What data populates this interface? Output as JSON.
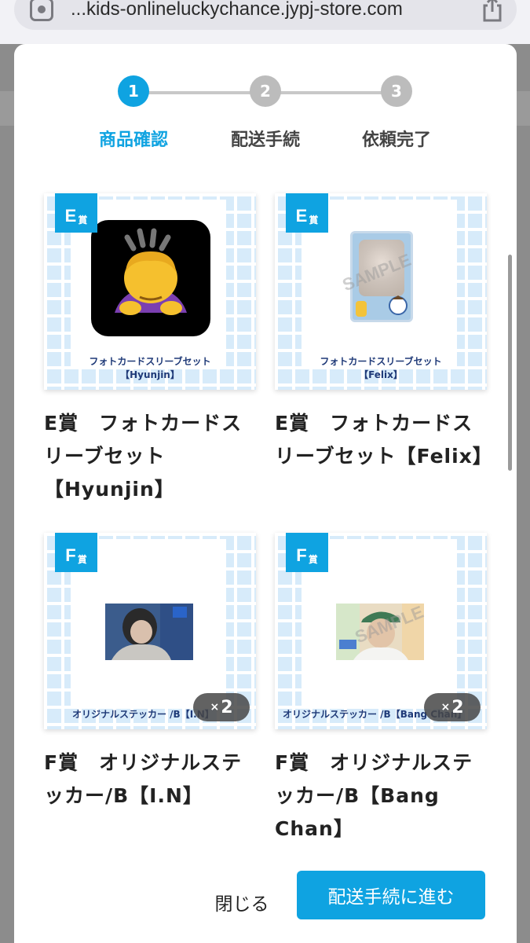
{
  "browser": {
    "url": "...kids-onlineluckychance.jypj-store.com"
  },
  "stepper": {
    "steps": [
      {
        "number": "1",
        "label": "商品確認"
      },
      {
        "number": "2",
        "label": "配送手続"
      },
      {
        "number": "3",
        "label": "依頼完了"
      }
    ]
  },
  "products": [
    {
      "badge": "E",
      "badge_suffix": "賞",
      "caption_line1": "フォトカードスリーブセット",
      "caption_line2": "【Hyunjin】",
      "title": "E賞　フォトカードスリーブセット【Hyunjin】",
      "qty": ""
    },
    {
      "badge": "E",
      "badge_suffix": "賞",
      "caption_line1": "フォトカードスリーブセット",
      "caption_line2": "【Felix】",
      "title": "E賞　フォトカードスリーブセット【Felix】",
      "qty": "",
      "watermark": "SAMPLE"
    },
    {
      "badge": "F",
      "badge_suffix": "賞",
      "caption_line1": "オリジナルステッカー /B【I.N】",
      "caption_line2": "",
      "title": "F賞　オリジナルステッカー/B【I.N】",
      "qty": "2",
      "qty_prefix": "×"
    },
    {
      "badge": "F",
      "badge_suffix": "賞",
      "caption_line1": "オリジナルステッカー /B【Bang Chan】",
      "caption_line2": "",
      "title": "F賞　オリジナルステッカー/B【Bang Chan】",
      "qty": "2",
      "qty_prefix": "×",
      "watermark": "SAMPLE"
    }
  ],
  "footer": {
    "close_label": "閉じる",
    "next_label": "配送手続に進む"
  },
  "colors": {
    "accent": "#0fa3e1",
    "inactive_step": "#bcbcbc"
  }
}
